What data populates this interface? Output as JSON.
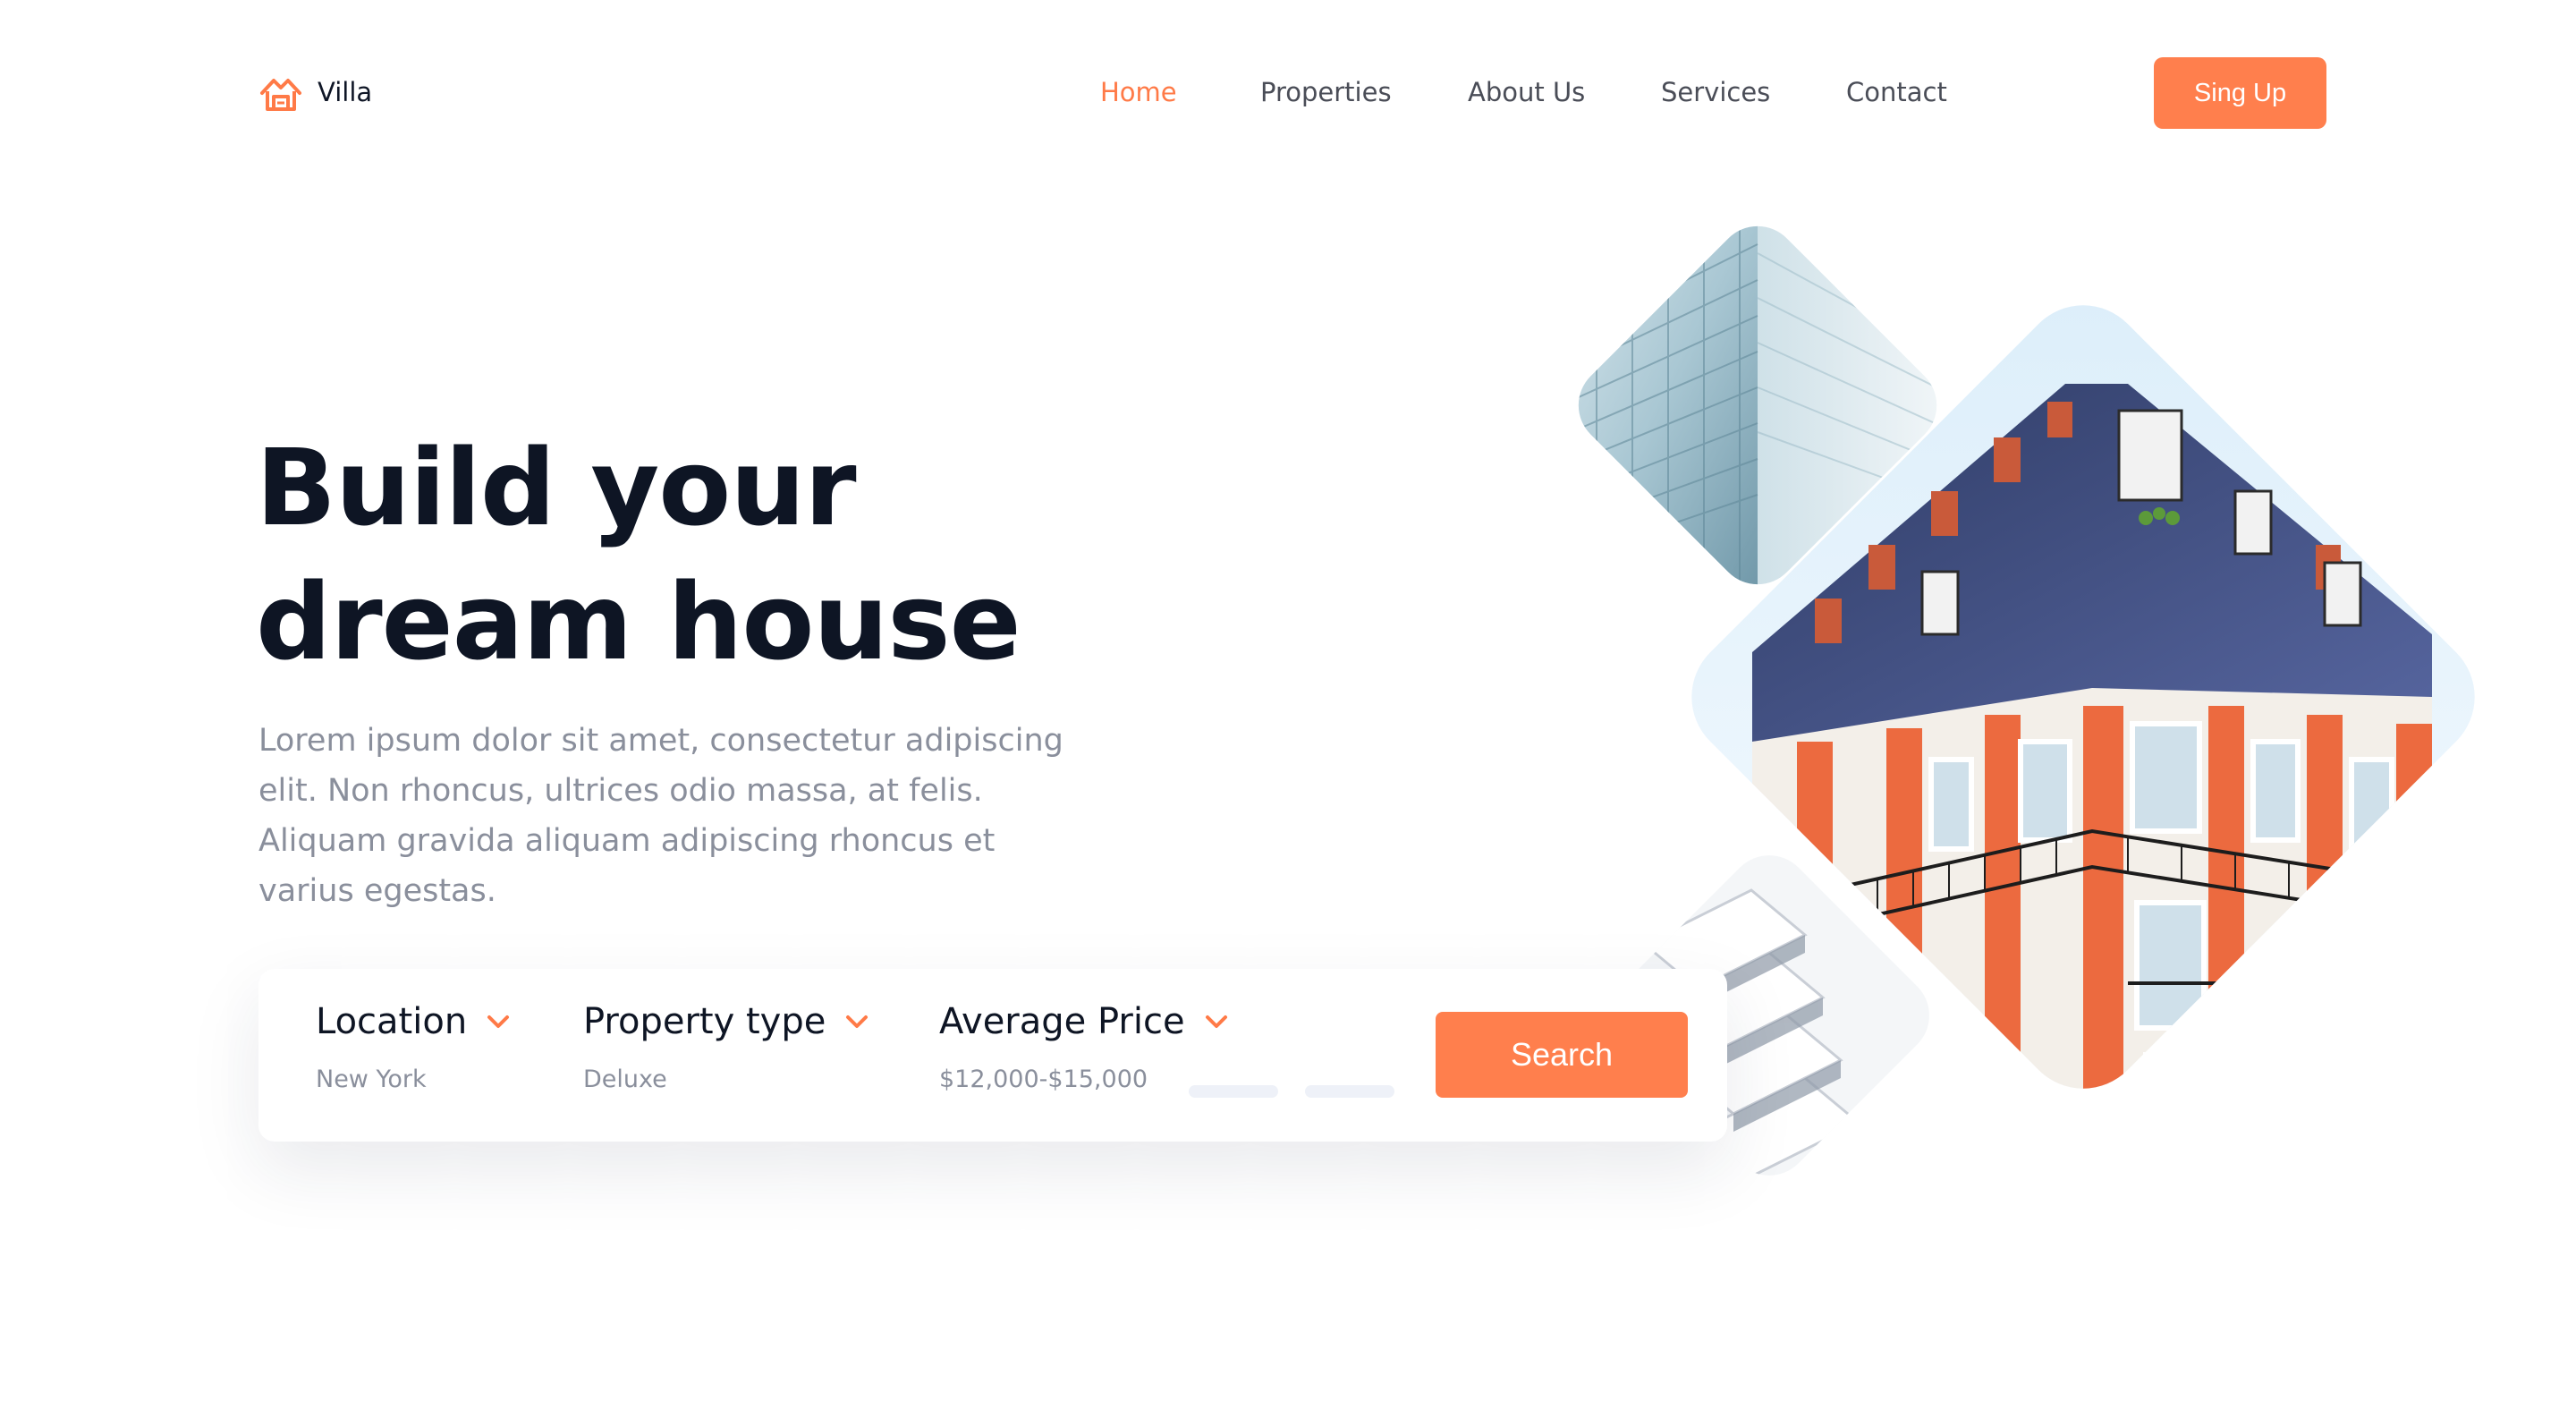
{
  "header": {
    "brand": "Villa",
    "logo_icon": "house-logo-icon",
    "nav": [
      {
        "label": "Home",
        "active": true
      },
      {
        "label": "Properties",
        "active": false
      },
      {
        "label": "About Us",
        "active": false
      },
      {
        "label": "Services",
        "active": false
      },
      {
        "label": "Contact",
        "active": false
      }
    ],
    "signup_label": "Sing Up"
  },
  "hero": {
    "title_line1": "Build your",
    "title_line2": "dream house",
    "description": "Lorem ipsum dolor sit amet, consectetur adipiscing elit. Non rhoncus, ultrices odio massa, at felis. Aliquam gravida aliquam adipiscing rhoncus et varius egestas."
  },
  "search": {
    "filters": [
      {
        "label": "Location",
        "value": "New York"
      },
      {
        "label": "Property type",
        "value": "Deluxe"
      },
      {
        "label": "Average Price",
        "value": "$12,000-$15,000"
      }
    ],
    "button_label": "Search"
  },
  "colors": {
    "accent": "#ff7f4d",
    "heading": "#0e1524",
    "muted": "#8a8f9c"
  }
}
